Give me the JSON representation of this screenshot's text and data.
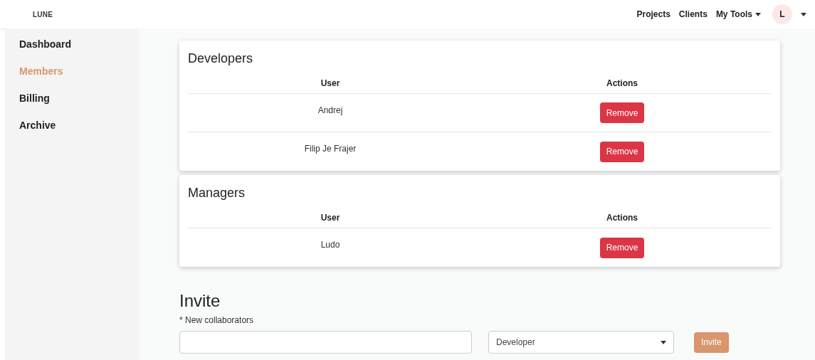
{
  "brand": "LUNE",
  "nav": [
    {
      "label": "Projects",
      "dropdown": false
    },
    {
      "label": "Clients",
      "dropdown": false
    },
    {
      "label": "My Tools",
      "dropdown": true
    }
  ],
  "avatar": {
    "initial": "L"
  },
  "sidebar": {
    "items": [
      {
        "label": "Dashboard",
        "selected": false
      },
      {
        "label": "Members",
        "selected": true
      },
      {
        "label": "Billing",
        "selected": false
      },
      {
        "label": "Archive",
        "selected": false
      }
    ]
  },
  "groups": [
    {
      "title": "Developers",
      "columns": [
        "User",
        "Actions"
      ],
      "rows": [
        {
          "user": "Andrej",
          "action": "Remove"
        },
        {
          "user": "Filip Je Frajer",
          "action": "Remove"
        }
      ]
    },
    {
      "title": "Managers",
      "columns": [
        "User",
        "Actions"
      ],
      "rows": [
        {
          "user": "Ludo",
          "action": "Remove"
        }
      ]
    }
  ],
  "invite": {
    "title": "Invite",
    "label": "* New collaborators",
    "role": "Developer",
    "button": "Invite"
  }
}
